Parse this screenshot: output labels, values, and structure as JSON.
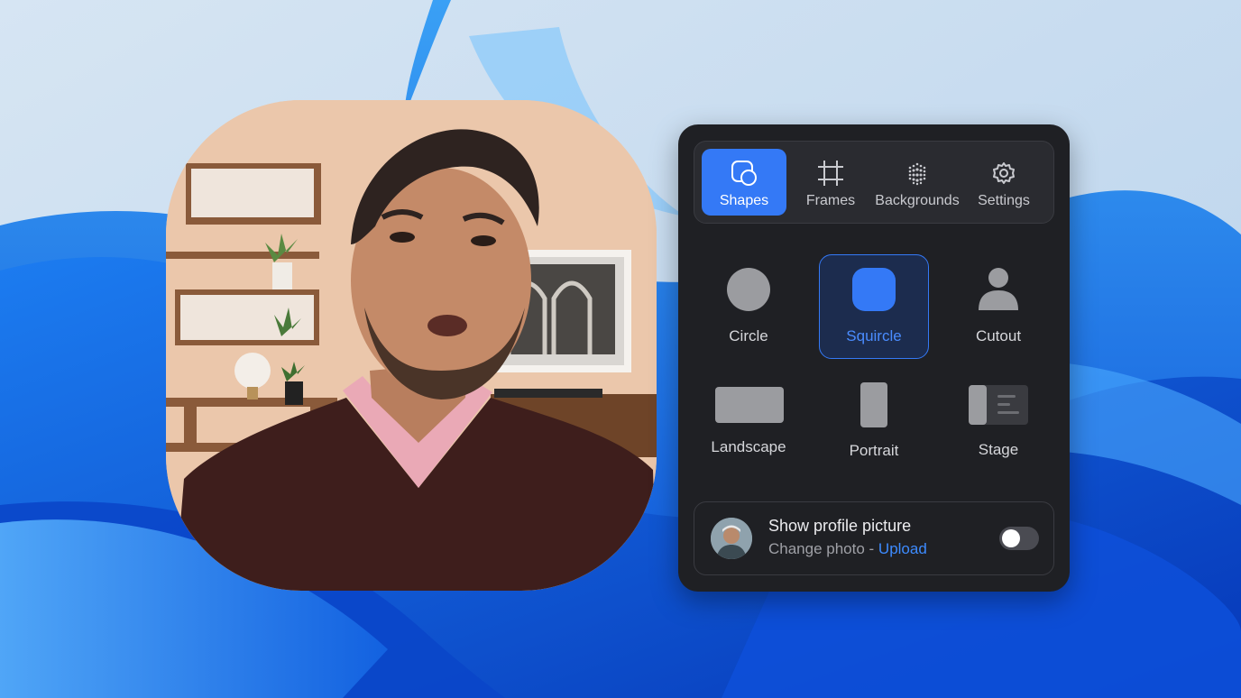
{
  "tabs": [
    {
      "label": "Shapes",
      "icon": "shapes-icon",
      "active": true
    },
    {
      "label": "Frames",
      "icon": "frame-crop-icon",
      "active": false
    },
    {
      "label": "Backgrounds",
      "icon": "dots-grid-icon",
      "active": false
    },
    {
      "label": "Settings",
      "icon": "gear-icon",
      "active": false
    }
  ],
  "shapes": [
    {
      "label": "Circle",
      "selected": false
    },
    {
      "label": "Squircle",
      "selected": true
    },
    {
      "label": "Cutout",
      "selected": false
    },
    {
      "label": "Landscape",
      "selected": false
    },
    {
      "label": "Portrait",
      "selected": false
    },
    {
      "label": "Stage",
      "selected": false
    }
  ],
  "profile": {
    "title": "Show profile picture",
    "subtitle": "Change photo - ",
    "link": "Upload",
    "toggle_on": false
  },
  "colors": {
    "accent": "#3479f6",
    "panel_bg": "#1f2024",
    "shape_fill": "#9b9ca0"
  }
}
